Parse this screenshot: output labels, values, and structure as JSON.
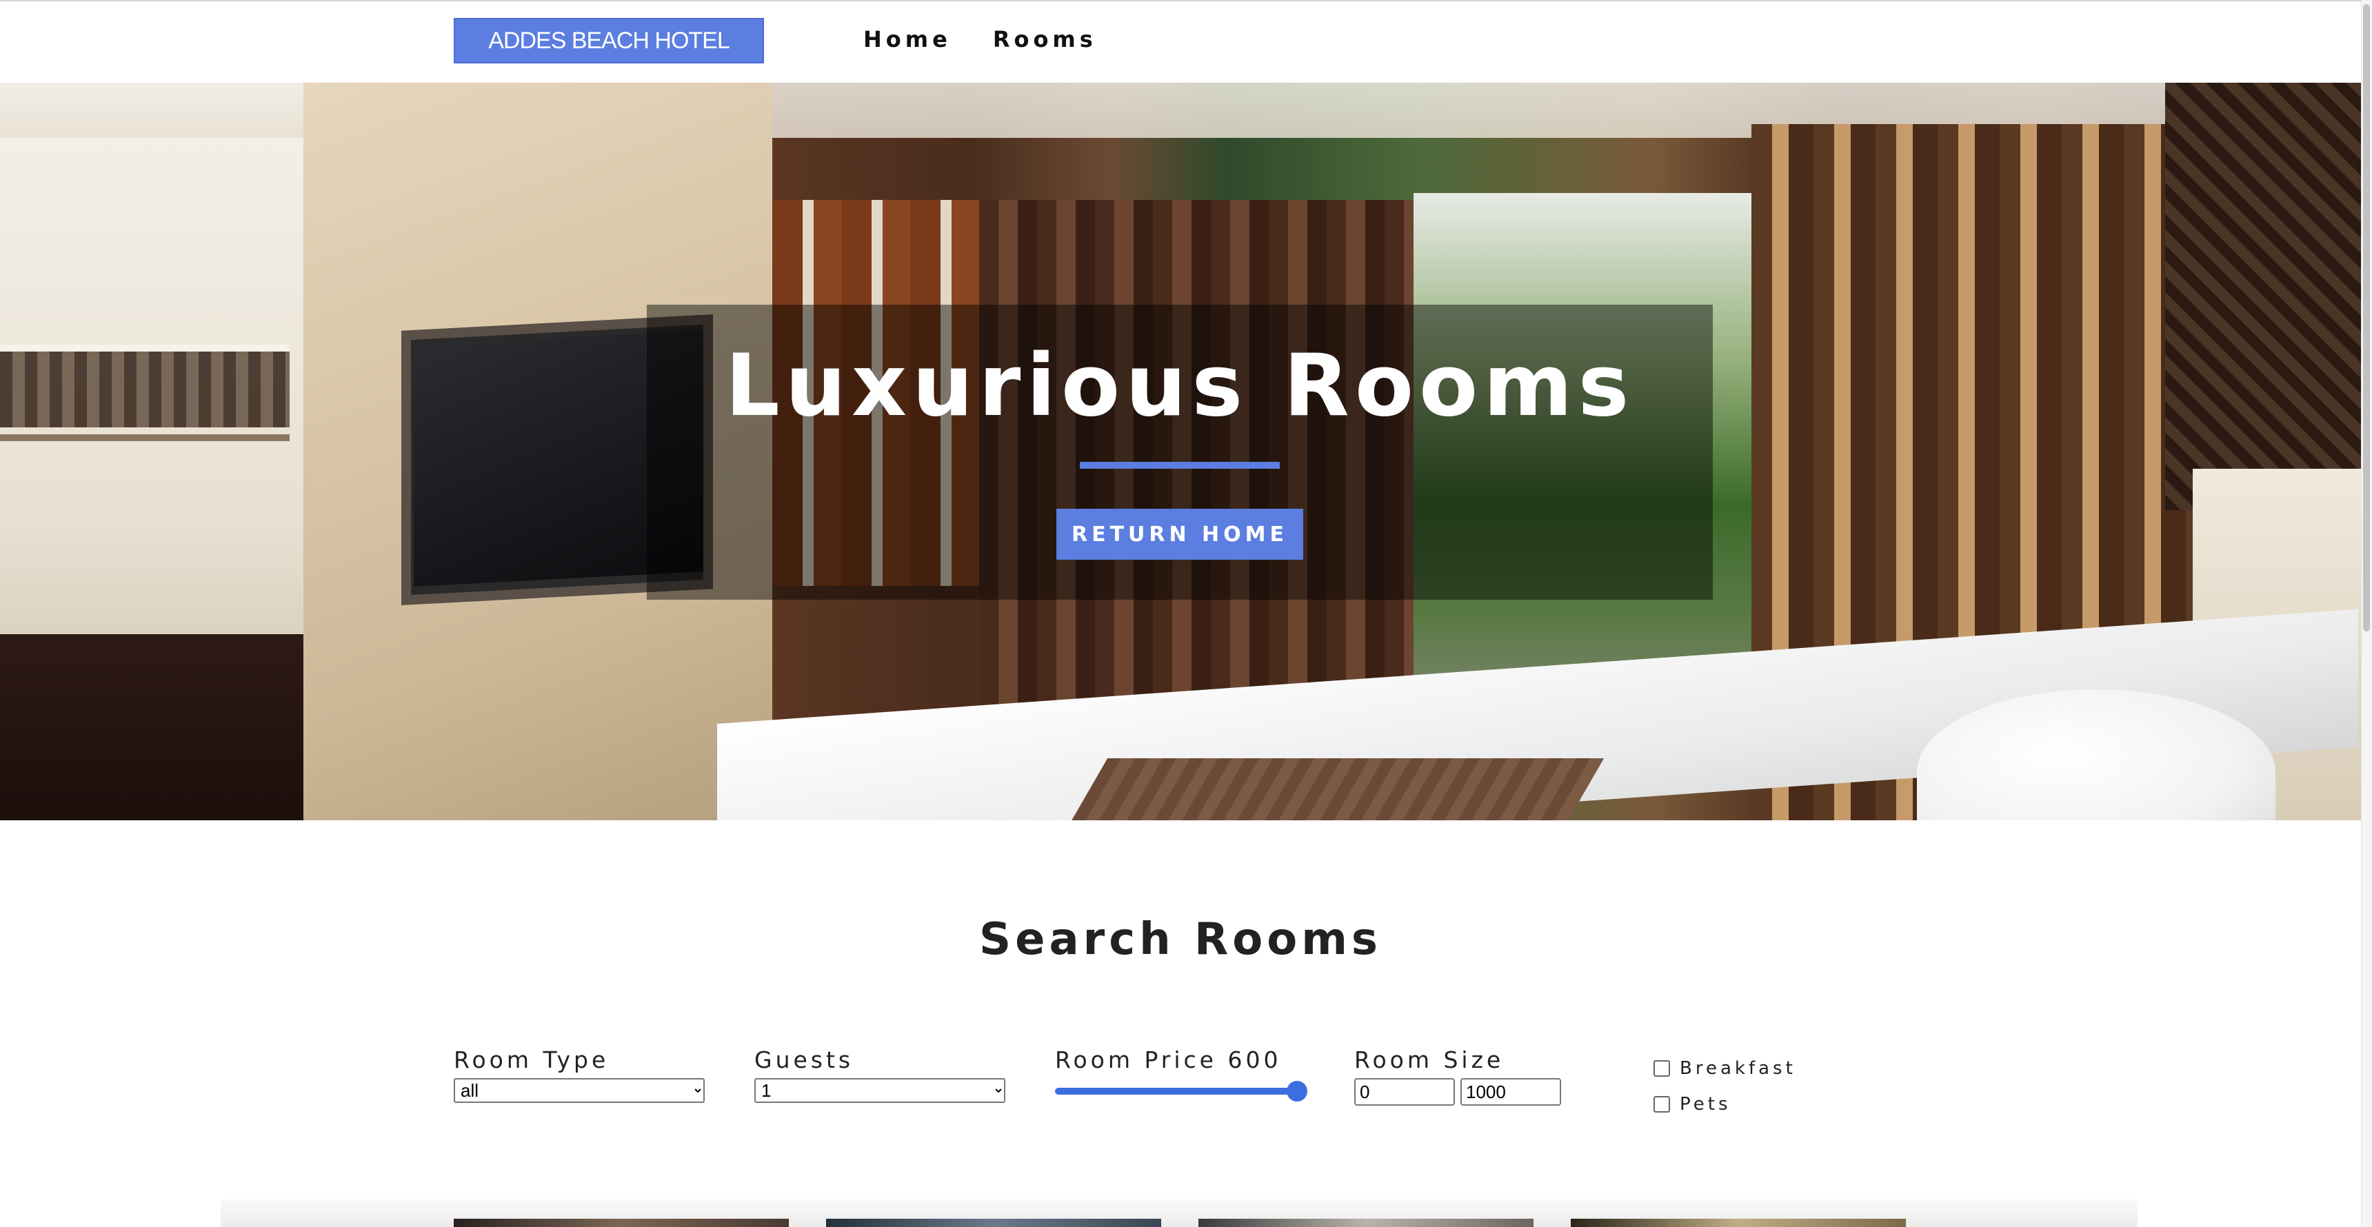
{
  "navbar": {
    "logo_text": "ADDES BEACH HOTEL",
    "links": [
      {
        "label": "Home"
      },
      {
        "label": "Rooms"
      }
    ]
  },
  "hero": {
    "title": "Luxurious Rooms",
    "button_label": "RETURN HOME"
  },
  "search": {
    "title": "Search Rooms",
    "room_type": {
      "label": "Room Type",
      "selected": "all"
    },
    "guests": {
      "label": "Guests",
      "selected": "1"
    },
    "price": {
      "label": "Room Price 600",
      "value_fraction": 1.0
    },
    "size": {
      "label": "Room Size",
      "min_value": "0",
      "max_value": "1000"
    },
    "breakfast": {
      "label": "Breakfast",
      "checked": false
    },
    "pets": {
      "label": "Pets",
      "checked": false
    }
  },
  "colors": {
    "accent": "#5b7ee0",
    "slider": "#3b6fe0"
  }
}
